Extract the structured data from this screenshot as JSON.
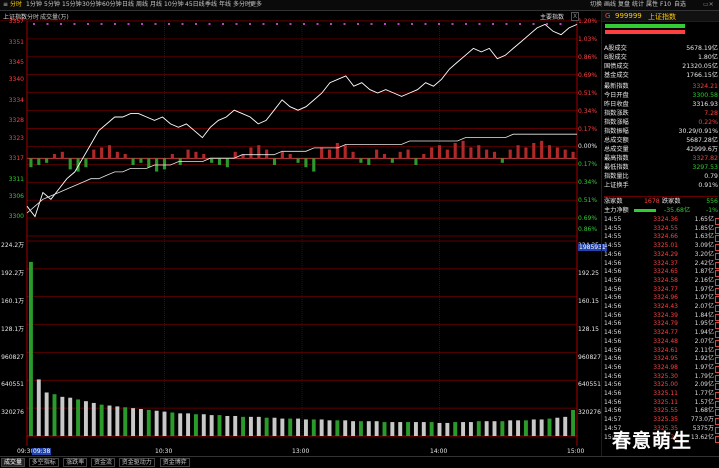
{
  "colors": {
    "up": "#ff4040",
    "down": "#33cc33",
    "neutral": "#e6e6e6",
    "grid": "#7a0000",
    "highlight": "#ffcc00"
  },
  "topbar": {
    "left_icon": "≡",
    "buttons": [
      "分时",
      "1分钟",
      "5分钟",
      "15分钟",
      "30分钟",
      "60分钟",
      "日线",
      "周线",
      "月线",
      "10分钟",
      "45日线",
      "季线",
      "年线",
      "多分时",
      "更多"
    ],
    "right_buttons": [
      "切换",
      "画线",
      "复盘",
      "统计",
      "属性",
      "F10",
      "自选"
    ]
  },
  "chart_header": {
    "title": "上证指数",
    "labels": [
      "分时",
      "成交量(万)"
    ],
    "right_label": "主要指数"
  },
  "chart_data": {
    "type": "line",
    "title": "上证指数",
    "prev_close": 3316.93,
    "price_axis": {
      "ylim": [
        3294.3,
        3357.0
      ],
      "ticks_left": [
        3357,
        3351,
        3345,
        3340,
        3334,
        3328,
        3323,
        3317,
        3311,
        3306,
        3300
      ],
      "ticks_right": [
        "1.20%",
        "1.03%",
        "0.86%",
        "0.69%",
        "0.51%",
        "0.34%",
        "0.17%",
        "0.00%",
        "0.17%",
        "0.34%",
        "0.51%",
        "0.69%",
        "0.86%"
      ]
    },
    "left_extra_ticks": [
      3300
    ],
    "volume_axis": {
      "ticks_left": [
        "224.2万",
        "192.2万",
        "160.1万",
        "128.1万",
        "960827",
        "640551",
        "320276"
      ],
      "ticks_right": [
        "224.25",
        "192.25",
        "160.15",
        "128.15",
        "960827",
        "640551",
        "320276"
      ],
      "cursor_value": "1985931"
    },
    "x_ticks": [
      "09:30",
      "10:30",
      "13:00",
      "14:00",
      "15:00"
    ],
    "x_cursor": "09:38",
    "series": [
      {
        "values": [
          3303,
          3300,
          3307,
          3305,
          3308,
          3311,
          3313,
          3317,
          3321,
          3325,
          3327,
          3329,
          3329,
          3330,
          3330,
          3329,
          3328,
          3329,
          3327,
          3326,
          3327,
          3325,
          3323,
          3326,
          3328,
          3329,
          3331,
          3330,
          3329,
          3327,
          3328,
          3331,
          3334,
          3332,
          3331,
          3332,
          3334,
          3336,
          3339,
          3340,
          3341,
          3338,
          3339,
          3337,
          3336,
          3337,
          3336,
          3335,
          3336,
          3337,
          3339,
          3338,
          3340,
          3343,
          3345,
          3347,
          3349,
          3348,
          3349,
          3346,
          3347,
          3349,
          3351,
          3353,
          3355,
          3356,
          3354,
          3353,
          3355,
          3356
        ]
      },
      {
        "values": [
          3301,
          3303,
          3305,
          3306,
          3307,
          3308,
          3309,
          3310,
          3311,
          3311,
          3312,
          3313,
          3313,
          3314,
          3314,
          3314,
          3315,
          3315,
          3315,
          3316,
          3316,
          3316,
          3316,
          3317,
          3317,
          3317,
          3317,
          3318,
          3318,
          3318,
          3318,
          3318,
          3319,
          3319,
          3319,
          3319,
          3320,
          3320,
          3320,
          3320,
          3321,
          3321,
          3321,
          3321,
          3321,
          3321,
          3321,
          3321,
          3322,
          3322,
          3322,
          3322,
          3322,
          3322,
          3322,
          3323,
          3323,
          3323,
          3323,
          3323,
          3323,
          3324,
          3324,
          3324,
          3324,
          3324,
          3324,
          3324,
          3324,
          3324
        ]
      }
    ],
    "volume_bars": [
      200,
      65,
      50,
      48,
      45,
      44,
      42,
      40,
      38,
      36,
      35,
      34,
      33,
      32,
      31,
      30,
      29,
      28,
      27,
      26,
      26,
      25,
      25,
      24,
      24,
      23,
      23,
      22,
      22,
      22,
      21,
      21,
      20,
      20,
      20,
      19,
      19,
      19,
      18,
      18,
      18,
      17,
      17,
      17,
      17,
      16,
      16,
      16,
      16,
      16,
      16,
      16,
      15,
      15,
      16,
      16,
      16,
      17,
      17,
      17,
      17,
      18,
      18,
      18,
      19,
      19,
      20,
      21,
      22,
      30
    ],
    "net_bars": [
      -4,
      -3,
      -2,
      2,
      3,
      -5,
      -6,
      -4,
      4,
      5,
      6,
      3,
      2,
      -3,
      -2,
      -4,
      -6,
      -5,
      2,
      -3,
      4,
      3,
      2,
      -2,
      -3,
      -4,
      3,
      2,
      5,
      6,
      4,
      -3,
      3,
      2,
      -2,
      -4,
      -6,
      5,
      4,
      7,
      6,
      3,
      -2,
      -3,
      4,
      2,
      -2,
      3,
      4,
      -3,
      2,
      5,
      6,
      4,
      7,
      8,
      5,
      6,
      4,
      3,
      -2,
      4,
      6,
      5,
      7,
      8,
      6,
      5,
      4,
      3
    ]
  },
  "right_panel": {
    "header": {
      "code": "999999",
      "name": "上证指数",
      "prefix": "G"
    },
    "summary": [
      {
        "k": "A股成交",
        "v": "5678.19亿"
      },
      {
        "k": "B股成交",
        "v": "1.80亿"
      },
      {
        "k": "国债成交",
        "v": "21320.05亿"
      },
      {
        "k": "基金成交",
        "v": "1766.15亿"
      }
    ],
    "stats": [
      {
        "k": "最新指数",
        "v": "3324.21",
        "c": "r"
      },
      {
        "k": "今日开盘",
        "v": "3300.58",
        "c": "g"
      },
      {
        "k": "昨日收盘",
        "v": "3316.93",
        "c": "w"
      },
      {
        "k": "指数涨跌",
        "v": "7.28",
        "c": "r"
      },
      {
        "k": "指数涨幅",
        "v": "0.22%",
        "c": "r"
      },
      {
        "k": "指数振幅",
        "v": "30.29/0.91%",
        "c": "w"
      },
      {
        "k": "总成交额",
        "v": "5687.28亿",
        "c": "w"
      },
      {
        "k": "总成交量",
        "v": "42999.6万",
        "c": "w"
      },
      {
        "k": "最高指数",
        "v": "3327.82",
        "c": "r"
      },
      {
        "k": "最低指数",
        "v": "3297.53",
        "c": "g"
      },
      {
        "k": "指数量比",
        "v": "0.79",
        "c": "w"
      },
      {
        "k": "上证换手",
        "v": "0.91%",
        "c": "w"
      }
    ],
    "breadth": {
      "up_label": "涨家数",
      "up": "1678",
      "down_label": "跌家数",
      "down": "556"
    },
    "main_flow": {
      "label": "主力净额",
      "value": "-35.68亿",
      "pct": "-1%"
    },
    "ticks": [
      {
        "t": "14:55",
        "p": "3324.36",
        "v": "1.65亿",
        "c": "r"
      },
      {
        "t": "14:55",
        "p": "3324.55",
        "v": "1.85亿",
        "c": "r"
      },
      {
        "t": "14:55",
        "p": "3324.66",
        "v": "1.63亿",
        "c": "r"
      },
      {
        "t": "14:55",
        "p": "3325.01",
        "v": "3.09亿",
        "c": "r"
      },
      {
        "t": "14:56",
        "p": "3324.29",
        "v": "3.20亿",
        "c": "r"
      },
      {
        "t": "14:56",
        "p": "3324.37",
        "v": "2.42亿",
        "c": "r"
      },
      {
        "t": "14:56",
        "p": "3324.65",
        "v": "1.87亿",
        "c": "r"
      },
      {
        "t": "14:56",
        "p": "3324.58",
        "v": "2.16亿",
        "c": "r"
      },
      {
        "t": "14:56",
        "p": "3324.77",
        "v": "1.97亿",
        "c": "r"
      },
      {
        "t": "14:56",
        "p": "3324.96",
        "v": "1.97亿",
        "c": "r"
      },
      {
        "t": "14:56",
        "p": "3324.43",
        "v": "2.07亿",
        "c": "r"
      },
      {
        "t": "14:56",
        "p": "3324.39",
        "v": "1.84亿",
        "c": "r"
      },
      {
        "t": "14:56",
        "p": "3324.79",
        "v": "1.95亿",
        "c": "r"
      },
      {
        "t": "14:56",
        "p": "3324.77",
        "v": "1.94亿",
        "c": "r"
      },
      {
        "t": "14:56",
        "p": "3324.48",
        "v": "2.07亿",
        "c": "r"
      },
      {
        "t": "14:56",
        "p": "3324.61",
        "v": "2.11亿",
        "c": "r"
      },
      {
        "t": "14:56",
        "p": "3324.95",
        "v": "1.92亿",
        "c": "r"
      },
      {
        "t": "14:56",
        "p": "3324.98",
        "v": "1.97亿",
        "c": "r"
      },
      {
        "t": "14:56",
        "p": "3325.30",
        "v": "1.79亿",
        "c": "r"
      },
      {
        "t": "14:56",
        "p": "3325.00",
        "v": "2.09亿",
        "c": "r"
      },
      {
        "t": "14:56",
        "p": "3325.11",
        "v": "1.77亿",
        "c": "r"
      },
      {
        "t": "14:56",
        "p": "3325.11",
        "v": "1.57亿",
        "c": "r"
      },
      {
        "t": "14:56",
        "p": "3325.55",
        "v": "1.68亿",
        "c": "r"
      },
      {
        "t": "14:57",
        "p": "3325.35",
        "v": "773.0万",
        "c": "r"
      },
      {
        "t": "14:57",
        "p": "3325.35",
        "v": "5375万",
        "c": "r"
      },
      {
        "t": "15:00",
        "p": "3324.21",
        "v": "13.62亿",
        "c": "r"
      }
    ]
  },
  "bottom_tabs": [
    "成交量",
    "多空指标",
    "涨跌率",
    "资金流",
    "资金驱动力",
    "资金博弈"
  ],
  "watermark": "春意萌生"
}
